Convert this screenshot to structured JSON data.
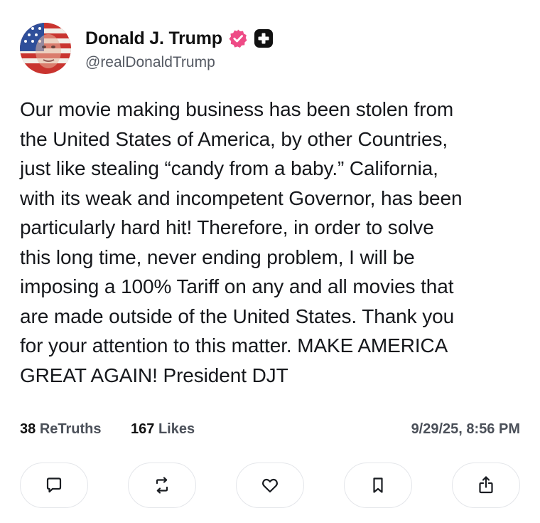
{
  "author": {
    "display_name": "Donald J. Trump",
    "handle": "@realDonaldTrump",
    "verified_icon": "verified-badge-icon",
    "plus_icon": "plus-badge-icon",
    "avatar_icon": "avatar"
  },
  "post": {
    "text": "Our movie making business has been stolen from\nthe United States of America, by other Countries,\njust like stealing “candy from a baby.” California,\nwith its weak and incompetent Governor, has been\nparticularly hard hit! Therefore, in order to solve\nthis long time, never ending problem, I will be\nimposing a 100% Tariff on any and all movies that\nare made outside of the United States. Thank you\nfor your attention to this matter. MAKE AMERICA\nGREAT AGAIN! President DJT"
  },
  "stats": {
    "retruths_count": "38",
    "retruths_label": "ReTruths",
    "likes_count": "167",
    "likes_label": "Likes",
    "timestamp": "9/29/25, 8:56 PM"
  },
  "actions": [
    "reply-icon",
    "retruth-icon",
    "like-icon",
    "bookmark-icon",
    "share-icon"
  ],
  "colors": {
    "verified": "#ee4b86",
    "text": "#16181c",
    "muted": "#555a63",
    "border": "#e4e6ea"
  }
}
